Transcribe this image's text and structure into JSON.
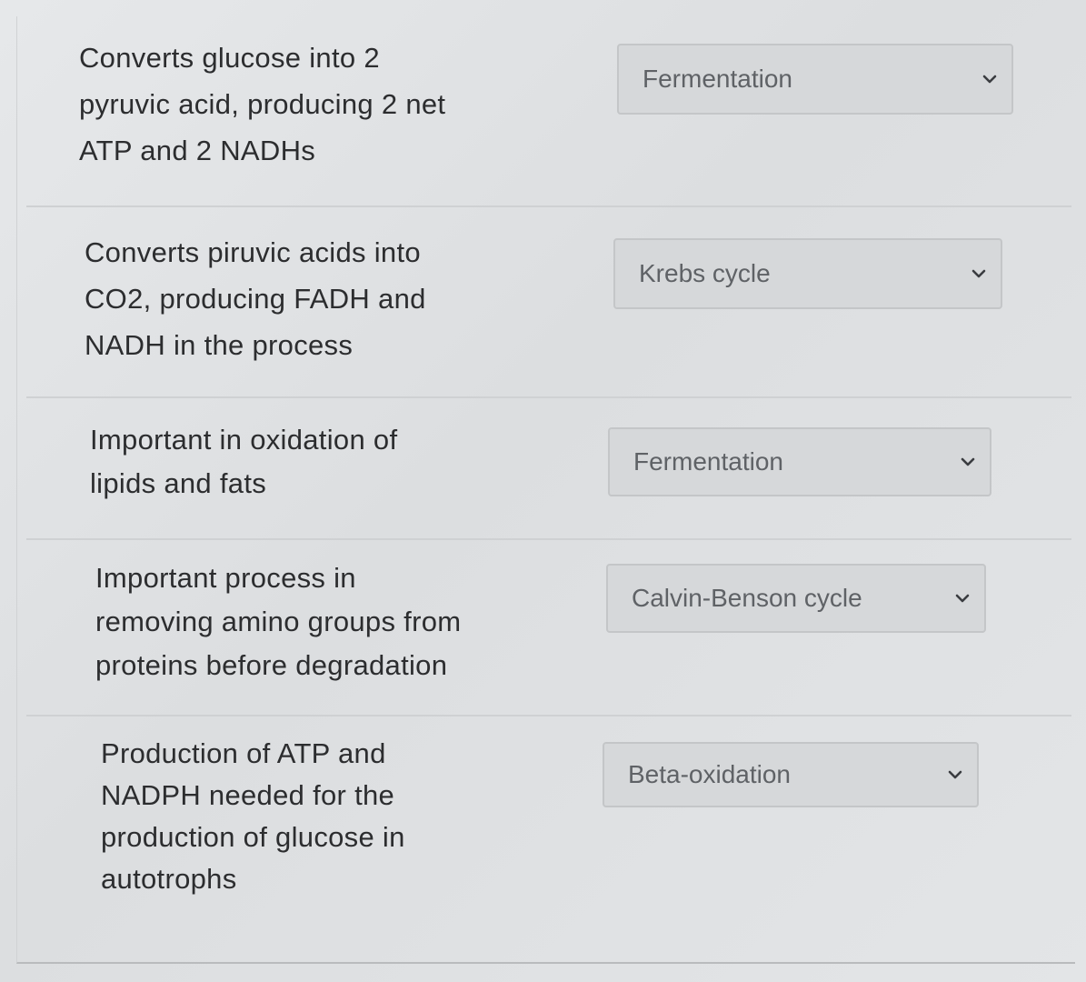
{
  "matching": {
    "rows": [
      {
        "prompt": "Converts glucose into 2\npyruvic acid, producing 2 net\nATP and 2 NADHs",
        "selected": "Fermentation"
      },
      {
        "prompt": "Converts piruvic acids into\nCO2, producing FADH and\nNADH in the process",
        "selected": "Krebs cycle"
      },
      {
        "prompt": "Important in oxidation of\nlipids and fats",
        "selected": "Fermentation"
      },
      {
        "prompt": "Important process in\nremoving amino groups from\nproteins before degradation",
        "selected": "Calvin-Benson cycle"
      },
      {
        "prompt": "Production of ATP and\nNADPH needed for the\nproduction of glucose in\nautotrophs",
        "selected": "Beta-oxidation"
      }
    ]
  }
}
